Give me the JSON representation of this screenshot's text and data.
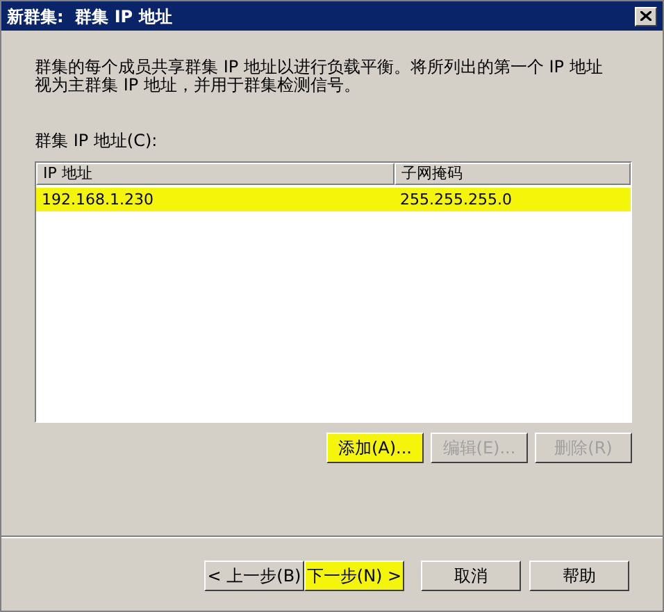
{
  "window": {
    "title": "新群集:  群集 IP 地址"
  },
  "description": "群集的每个成员共享群集 IP 地址以进行负载平衡。将所列出的第一个 IP 地址视为主群集 IP 地址，并用于群集检测信号。",
  "list_label": "群集 IP 地址(C):",
  "table": {
    "columns": [
      "IP 地址",
      "子网掩码"
    ],
    "rows": [
      {
        "cells": [
          "192.168.1.230",
          "255.255.255.0"
        ],
        "highlighted": true
      }
    ]
  },
  "list_buttons": [
    {
      "label": "添加(A)...",
      "disabled": false,
      "highlighted": true
    },
    {
      "label": "编辑(E)...",
      "disabled": true,
      "highlighted": false
    },
    {
      "label": "删除(R)",
      "disabled": true,
      "highlighted": false
    }
  ],
  "nav_buttons": [
    {
      "label": "< 上一步(B)",
      "disabled": false,
      "highlighted": false
    },
    {
      "label": "下一步(N) >",
      "disabled": false,
      "highlighted": true
    },
    {
      "label": "取消",
      "disabled": false,
      "highlighted": false
    },
    {
      "label": "帮助",
      "disabled": false,
      "highlighted": false
    }
  ]
}
